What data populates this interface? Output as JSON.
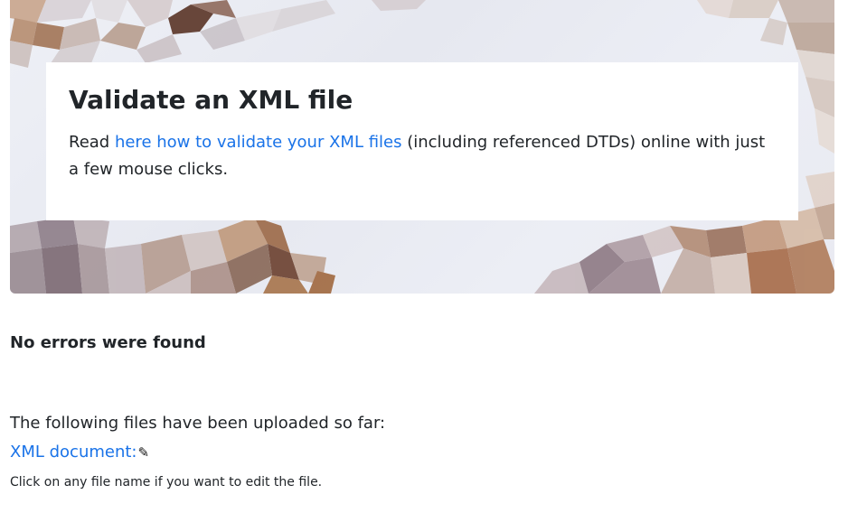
{
  "hero": {
    "title": "Validate an XML file",
    "intro_prefix": "Read ",
    "intro_link": "here how to validate your XML files",
    "intro_suffix": " (including referenced DTDs) online with just a few mouse clicks."
  },
  "result": {
    "status": "No errors were found"
  },
  "uploads": {
    "intro": "The following files have been uploaded so far:",
    "files": [
      {
        "label": "XML document:",
        "edit_icon": "pencil-icon"
      }
    ],
    "hint": "Click on any file name if you want to edit the file."
  },
  "colors": {
    "link": "#1a73e8",
    "text": "#212529",
    "hero_background": "#eceef5"
  }
}
